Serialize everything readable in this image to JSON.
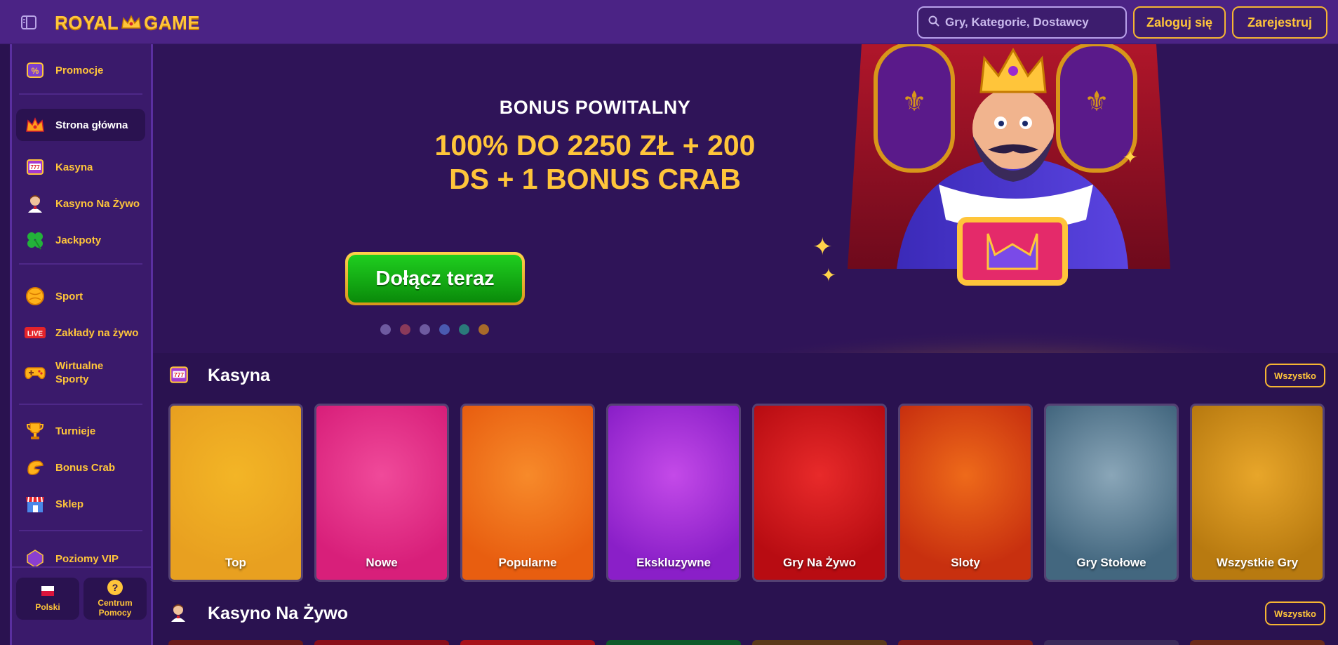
{
  "header": {
    "logo_text_left": "ROYAL",
    "logo_text_right": "GAME",
    "search_placeholder": "Gry, Kategorie, Dostawcy",
    "login_label": "Zaloguj się",
    "register_label": "Zarejestruj"
  },
  "sidebar": {
    "items": [
      {
        "label": "Promocje",
        "icon": "ticket-icon"
      },
      {
        "label": "Strona główna",
        "icon": "crown-home-icon"
      },
      {
        "label": "Kasyna",
        "icon": "slot-machine-icon"
      },
      {
        "label": "Kasyno Na Żywo",
        "icon": "dealer-icon"
      },
      {
        "label": "Jackpoty",
        "icon": "clover-icon"
      },
      {
        "label": "Sport",
        "icon": "ball-icon"
      },
      {
        "label": "Zakłady na żywo",
        "icon": "live-badge-icon",
        "badge": "LIVE"
      },
      {
        "label": "Wirtualne Sporty",
        "icon": "gamepad-icon"
      },
      {
        "label": "Turnieje",
        "icon": "trophy-icon"
      },
      {
        "label": "Bonus Crab",
        "icon": "crab-claw-icon"
      },
      {
        "label": "Sklep",
        "icon": "shop-icon"
      },
      {
        "label": "Poziomy VIP",
        "icon": "vip-gem-icon"
      }
    ],
    "language_label": "Polski",
    "help_label": "Centrum Pomocy",
    "help_icon_glyph": "?"
  },
  "hero": {
    "subtitle": "BONUS POWITALNY",
    "title": "100% DO 2250 ZŁ + 200 DS + 1 BONUS CRAB",
    "cta_label": "Dołącz teraz"
  },
  "sections": {
    "casinos": {
      "title": "Kasyna",
      "all_label": "Wszystko"
    },
    "live": {
      "title": "Kasyno Na Żywo",
      "all_label": "Wszystko"
    }
  },
  "categories": [
    {
      "label": "Top",
      "colors": [
        "#e8a020",
        "#f3b526"
      ]
    },
    {
      "label": "Nowe",
      "colors": [
        "#d81f7a",
        "#f04a9a"
      ]
    },
    {
      "label": "Popularne",
      "colors": [
        "#e85e10",
        "#f78a2a"
      ]
    },
    {
      "label": "Ekskluzywne",
      "colors": [
        "#8a1fc8",
        "#c44ae8"
      ]
    },
    {
      "label": "Gry Na Żywo",
      "colors": [
        "#b80c12",
        "#e82a2a"
      ]
    },
    {
      "label": "Sloty",
      "colors": [
        "#c8300f",
        "#ee6a1a"
      ]
    },
    {
      "label": "Gry Stołowe",
      "colors": [
        "#43677f",
        "#8aa6b8"
      ]
    },
    {
      "label": "Wszystkie Gry",
      "colors": [
        "#b87a10",
        "#e8a62a"
      ]
    }
  ],
  "colors": {
    "accent": "#ffc53a",
    "header_bg": "#4b2385",
    "page_bg": "#2a1250",
    "cta_green": "#1fbf1f"
  }
}
